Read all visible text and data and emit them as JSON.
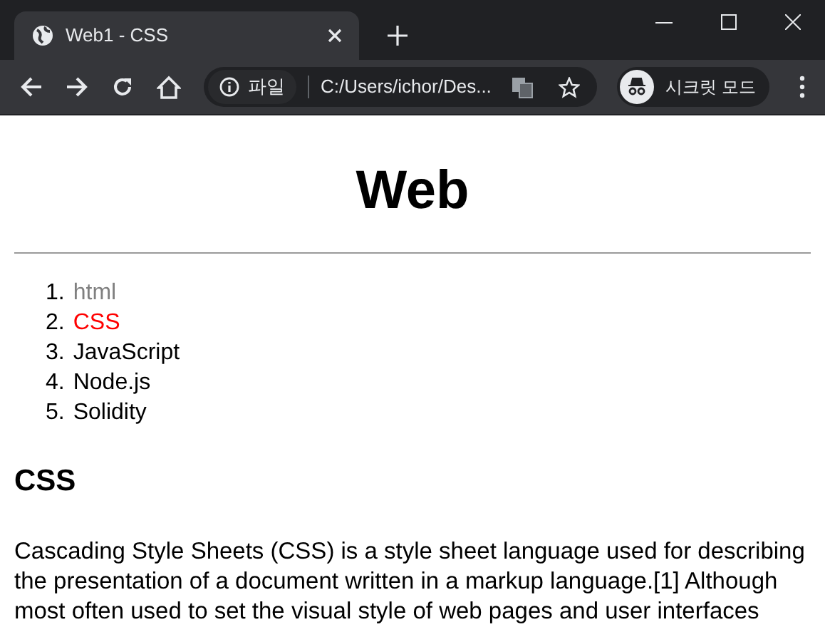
{
  "window": {
    "tab_title": "Web1 - CSS"
  },
  "toolbar": {
    "scheme": "파일",
    "address": "C:/Users/ichor/Des...",
    "profile": "시크릿 모드"
  },
  "page": {
    "heading": "Web",
    "nav": [
      {
        "number": "1.",
        "label": "html",
        "kind": "visited"
      },
      {
        "number": "2.",
        "label": "CSS",
        "kind": "active"
      },
      {
        "number": "3.",
        "label": "JavaScript",
        "kind": "unvisited"
      },
      {
        "number": "4.",
        "label": "Node.js",
        "kind": "unvisited"
      },
      {
        "number": "5.",
        "label": "Solidity",
        "kind": "unvisited"
      }
    ],
    "section_title": "CSS",
    "paragraph": "Cascading Style Sheets (CSS) is a style sheet language used for describing the presentation of a document written in a markup language.[1] Although most often used to set the visual style of web pages and user interfaces"
  }
}
